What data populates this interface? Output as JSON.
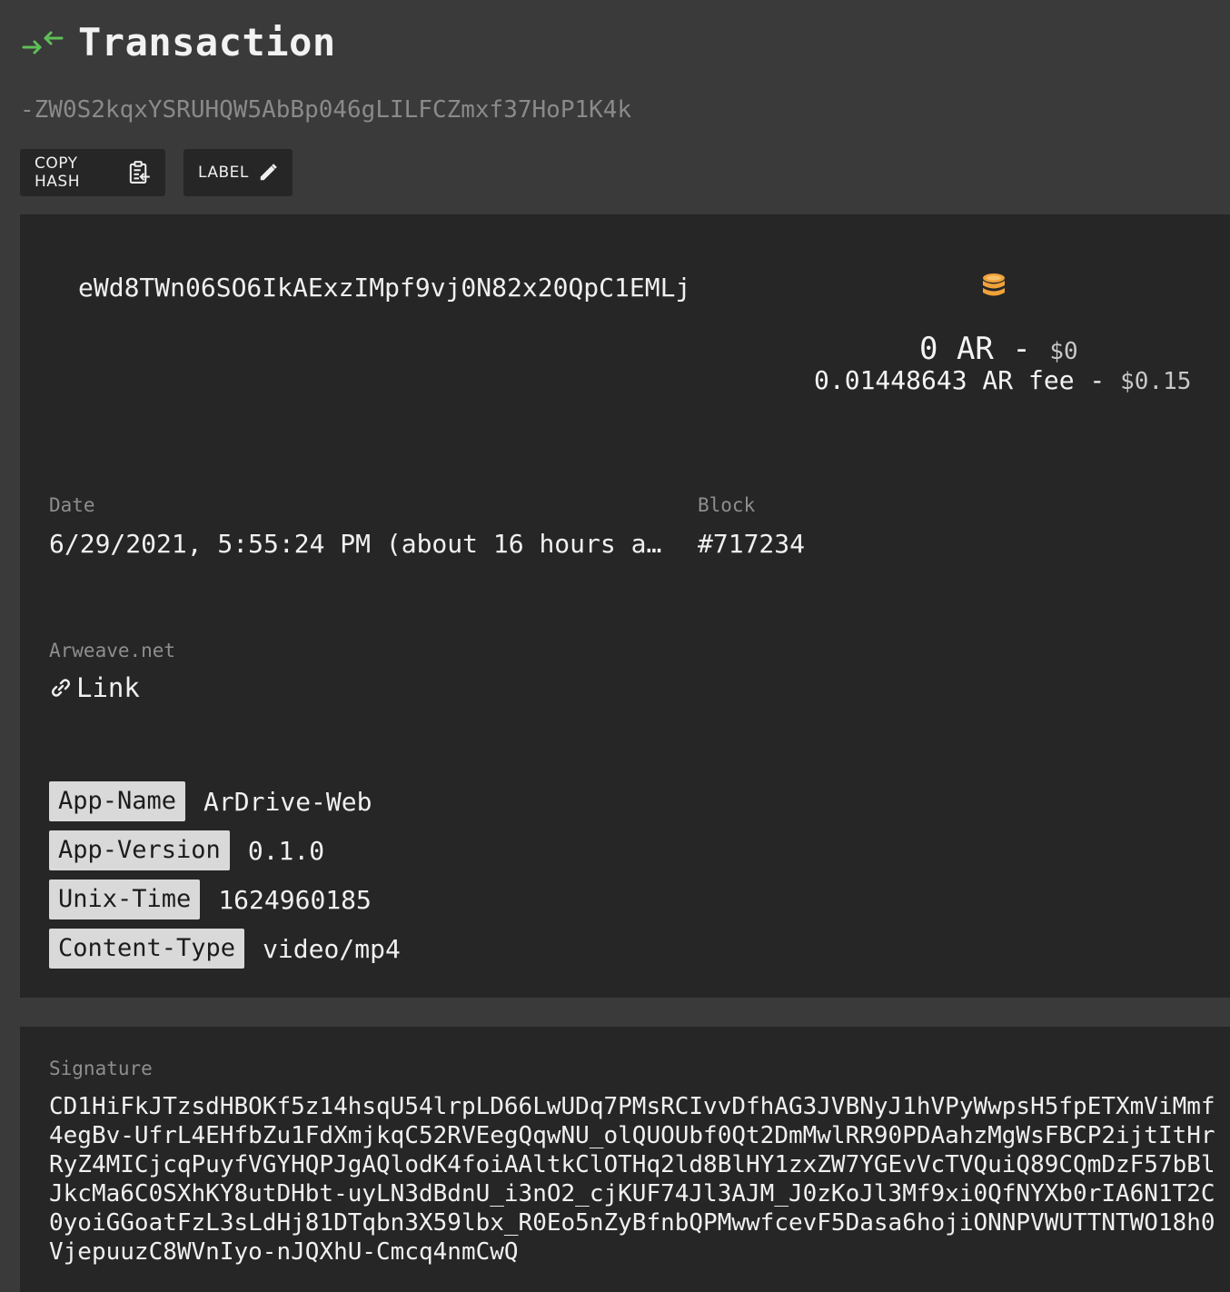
{
  "header": {
    "title": "Transaction",
    "icon": "transfer-arrows-icon",
    "accent_color": "#5fbf57"
  },
  "transaction": {
    "hash": "-ZW0S2kqxYSRUHQW5AbBp046gLILFCZmxf37HoP1K4k"
  },
  "toolbar": {
    "copy_hash_label": "COPY HASH",
    "label_label": "LABEL"
  },
  "details": {
    "owner": "eWd8TWn06SO6IkAExzIMpf9vj0N82x20QpC1EMLj",
    "amount": "0 AR",
    "amount_separator": " - ",
    "amount_usd": "$0",
    "fee": "0.01448643 AR fee",
    "fee_separator": " - ",
    "fee_usd": "$0.15",
    "date_label": "Date",
    "date_value": "6/29/2021, 5:55:24 PM (about 16 hours a…",
    "block_label": "Block",
    "block_value": "#717234",
    "net_label": "Arweave.net",
    "link_label": "Link",
    "coin_icon_color": "#f0a23a"
  },
  "tags": [
    {
      "key": "App-Name",
      "value": "ArDrive-Web"
    },
    {
      "key": "App-Version",
      "value": "0.1.0"
    },
    {
      "key": "Unix-Time",
      "value": "1624960185"
    },
    {
      "key": "Content-Type",
      "value": "video/mp4"
    }
  ],
  "signature": {
    "label": "Signature",
    "value": "CD1HiFkJTzsdHBOKf5z14hsqU54lrpLD66LwUDq7PMsRCIvvDfhAG3JVBNyJ1hVPyWwpsH5fpETXmViMmf\n4egBv-UfrL4EHfbZu1FdXmjkqC52RVEegQqwNU_olQUOUbf0Qt2DmMwlRR90PDAahzMgWsFBCP2ijtItHr\nRyZ4MICjcqPuyfVGYHQPJgAQlodK4foiAAltkClOTHq2ld8BlHY1zxZW7YGEvVcTVQuiQ89CQmDzF57bBl\nJkcMa6C0SXhKY8utDHbt-uyLN3dBdnU_i3nO2_cjKUF74Jl3AJM_J0zKoJl3Mf9xi0QfNYXb0rIA6N1T2C\n0yoiGGoatFzL3sLdHj81DTqbn3X59lbx_R0Eo5nZyBfnbQPMwwfcevF5Dasa6hojiONNPVWUTTNTWO18h0\nVjepuuzC8WVnIyo-nJQXhU-Cmcq4nmCwQ"
  }
}
